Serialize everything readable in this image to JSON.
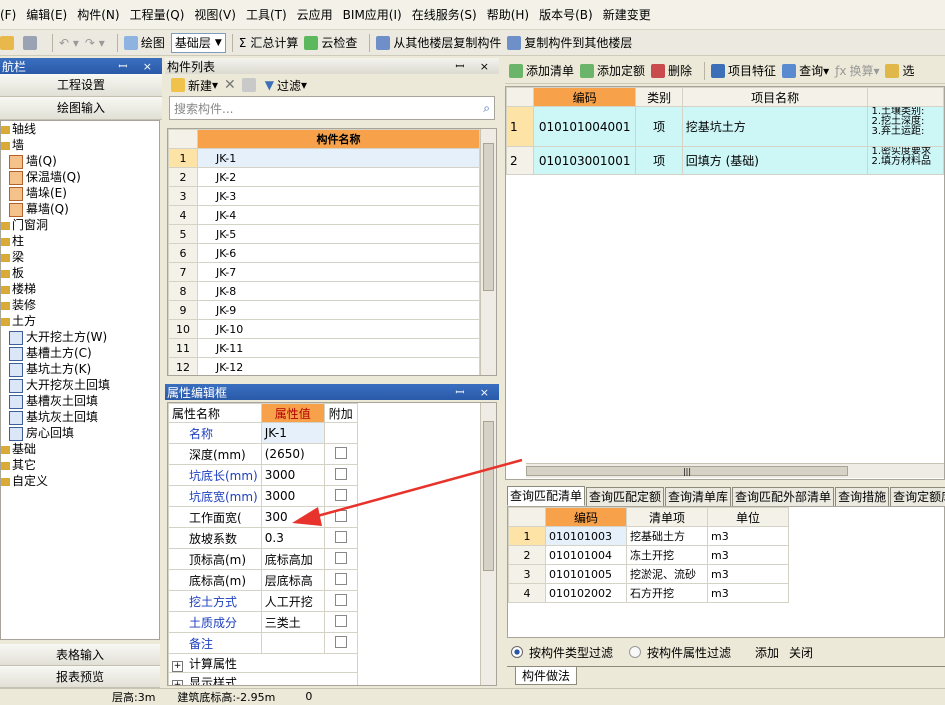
{
  "menu": [
    "(F)",
    "编辑(E)",
    "构件(N)",
    "工程量(Q)",
    "视图(V)",
    "工具(T)",
    "云应用",
    "BIM应用(I)",
    "在线服务(S)",
    "帮助(H)",
    "版本号(B)",
    "新建变更"
  ],
  "toolbar": {
    "draw_label": "绘图",
    "floor_value": "基础层",
    "sum_label": "汇总计算",
    "cloud_check_label": "云检查",
    "copy_from_label": "从其他楼层复制构件",
    "copy_to_label": "复制构件到其他楼层"
  },
  "nav": {
    "title": "航栏",
    "project_settings": "工程设置",
    "draw_input": "绘图输入",
    "tree": [
      {
        "label": "轴线",
        "level": 0
      },
      {
        "label": "墙",
        "level": 0
      },
      {
        "label": "墙(Q)",
        "level": 1
      },
      {
        "label": "保温墙(Q)",
        "level": 1
      },
      {
        "label": "墙垛(E)",
        "level": 1
      },
      {
        "label": "幕墙(Q)",
        "level": 1
      },
      {
        "label": "门窗洞",
        "level": 0
      },
      {
        "label": "柱",
        "level": 0
      },
      {
        "label": "梁",
        "level": 0
      },
      {
        "label": "板",
        "level": 0
      },
      {
        "label": "楼梯",
        "level": 0
      },
      {
        "label": "装修",
        "level": 0
      },
      {
        "label": "土方",
        "level": 0
      },
      {
        "label": "大开挖土方(W)",
        "level": 1
      },
      {
        "label": "基槽土方(C)",
        "level": 1
      },
      {
        "label": "基坑土方(K)",
        "level": 1
      },
      {
        "label": "大开挖灰土回填",
        "level": 1
      },
      {
        "label": "基槽灰土回填",
        "level": 1
      },
      {
        "label": "基坑灰土回填",
        "level": 1
      },
      {
        "label": "房心回填",
        "level": 1
      },
      {
        "label": "基础",
        "level": 0
      },
      {
        "label": "其它",
        "level": 0
      },
      {
        "label": "自定义",
        "level": 0
      }
    ],
    "table_input": "表格输入",
    "report_preview": "报表预览"
  },
  "component_list": {
    "title": "构件列表",
    "new_label": "新建",
    "filter_label": "过滤",
    "search_placeholder": "搜索构件...",
    "column": "构件名称",
    "rows": [
      "JK-1",
      "JK-2",
      "JK-3",
      "JK-4",
      "JK-5",
      "JK-6",
      "JK-7",
      "JK-8",
      "JK-9",
      "JK-10",
      "JK-11",
      "JK-12"
    ]
  },
  "property_editor": {
    "title": "属性编辑框",
    "col_name": "属性名称",
    "col_value": "属性值",
    "col_attach": "附加",
    "rows": [
      {
        "name": "名称",
        "value": "JK-1",
        "blue": true,
        "check": false
      },
      {
        "name": "深度(mm)",
        "value": "(2650)",
        "blue": false,
        "check": true
      },
      {
        "name": "坑底长(mm)",
        "value": "3000",
        "blue": true,
        "check": true
      },
      {
        "name": "坑底宽(mm)",
        "value": "3000",
        "blue": true,
        "check": true
      },
      {
        "name": "工作面宽(",
        "value": "300",
        "blue": false,
        "check": true
      },
      {
        "name": "放坡系数",
        "value": "0.3",
        "blue": false,
        "check": true
      },
      {
        "name": "顶标高(m)",
        "value": "底标高加",
        "blue": false,
        "check": true
      },
      {
        "name": "底标高(m)",
        "value": "层底标高",
        "blue": false,
        "check": true
      },
      {
        "name": "挖土方式",
        "value": "人工开挖",
        "blue": true,
        "check": true
      },
      {
        "name": "土质成分",
        "value": "三类土",
        "blue": true,
        "check": true
      },
      {
        "name": "备注",
        "value": "",
        "blue": true,
        "check": true
      }
    ],
    "group1": "计算属性",
    "group2": "显示样式"
  },
  "right_toolbar": {
    "add_item": "添加清单",
    "add_quota": "添加定额",
    "delete": "删除",
    "feature": "项目特征",
    "query": "查询",
    "convert": "换算",
    "select": "选"
  },
  "bill_table": {
    "col_code": "编码",
    "col_type": "类别",
    "col_name": "项目名称",
    "rows": [
      {
        "idx": "1",
        "code": "010101004001",
        "type": "项",
        "name": "挖基坑土方",
        "feature": [
          "1.土壤类别:",
          "2.挖土深度:",
          "3.弃土运距:"
        ]
      },
      {
        "idx": "2",
        "code": "010103001001",
        "type": "项",
        "name": "回填方 (基础)",
        "feature": [
          "1.密实度要求",
          "2.填方材料品"
        ]
      }
    ]
  },
  "match_tabs": [
    "查询匹配清单",
    "查询匹配定额",
    "查询清单库",
    "查询匹配外部清单",
    "查询措施",
    "查询定额库"
  ],
  "match_table": {
    "col_code": "编码",
    "col_item": "清单项",
    "col_unit": "单位",
    "rows": [
      {
        "idx": "1",
        "code": "010101003",
        "item": "挖基础土方",
        "unit": "m3"
      },
      {
        "idx": "2",
        "code": "010101004",
        "item": "冻土开挖",
        "unit": "m3"
      },
      {
        "idx": "3",
        "code": "010101005",
        "item": "挖淤泥、流砂",
        "unit": "m3"
      },
      {
        "idx": "4",
        "code": "010102002",
        "item": "石方开挖",
        "unit": "m3"
      }
    ]
  },
  "filters": {
    "by_type": "按构件类型过滤",
    "by_attr": "按构件属性过滤",
    "add": "添加",
    "close": "关闭"
  },
  "bottom_tab": "构件做法",
  "status": {
    "floor_height": "层高:3m",
    "base_elev": "建筑底标高:-2.95m",
    "zero": "0"
  }
}
